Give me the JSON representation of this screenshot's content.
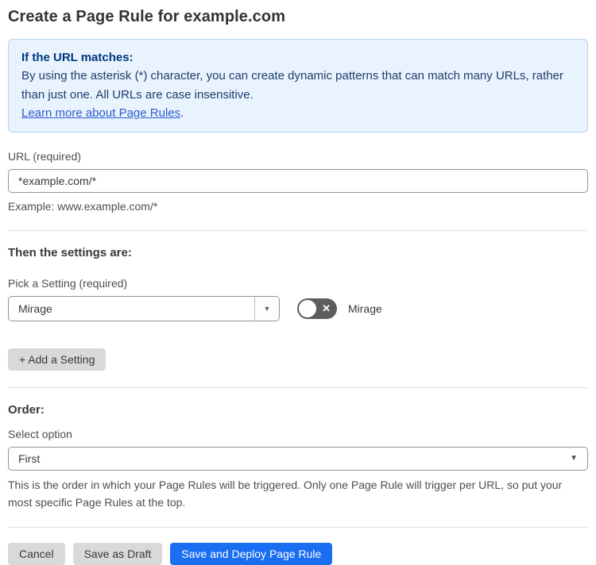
{
  "page": {
    "title": "Create a Page Rule for example.com"
  },
  "info_box": {
    "heading": "If the URL matches:",
    "body": "By using the asterisk (*) character, you can create dynamic patterns that can match many URLs, rather than just one. All URLs are case insensitive.",
    "link_label": "Learn more about Page Rules",
    "link_suffix": "."
  },
  "url_field": {
    "label": "URL (required)",
    "value": "*example.com/*",
    "helper": "Example: www.example.com/*"
  },
  "settings_section": {
    "heading": "Then the settings are:",
    "picker_label": "Pick a Setting (required)",
    "selected_setting": "Mirage",
    "dropdown_caret": "▼",
    "toggle_state": "off",
    "toggle_x_glyph": "✕",
    "toggle_label": "Mirage",
    "add_button_label": "+ Add a Setting"
  },
  "order_section": {
    "heading": "Order:",
    "select_label": "Select option",
    "selected_option": "First",
    "select_caret": "▼",
    "helper": "This is the order in which your Page Rules will be triggered. Only one Page Rule will trigger per URL, so put your most specific Page Rules at the top."
  },
  "footer": {
    "cancel_label": "Cancel",
    "save_draft_label": "Save as Draft",
    "save_deploy_label": "Save and Deploy Page Rule"
  },
  "colors": {
    "accent_blue": "#1a6ef2",
    "info_background": "#e9f3fd",
    "info_border": "#b6d3f2",
    "info_heading_text": "#003681",
    "info_body_text": "#1e3c6e",
    "link_blue": "#2d5cd0",
    "toggle_off_background": "#5d5d5d",
    "button_gray": "#d9d9d9"
  }
}
